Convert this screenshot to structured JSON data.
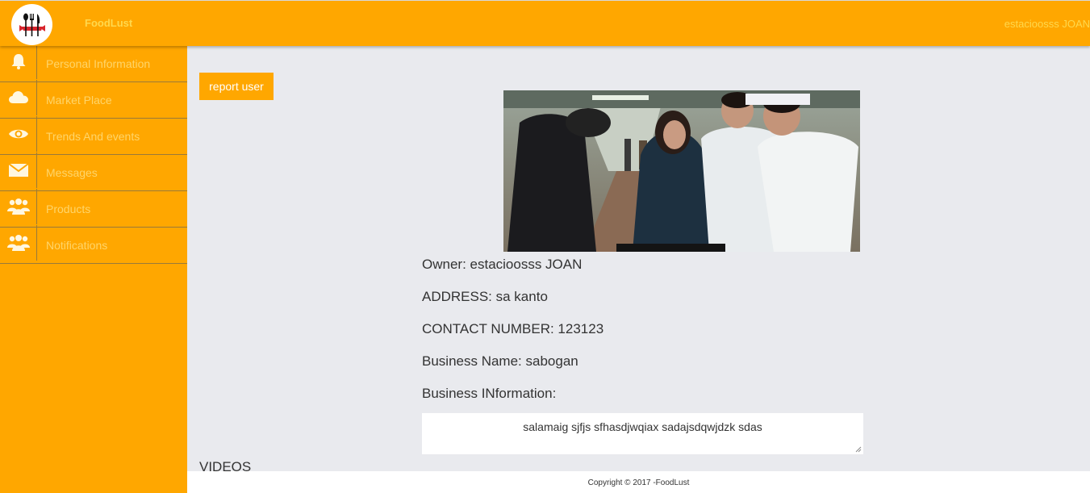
{
  "header": {
    "brand": "FoodLust",
    "user_name": "estacioosss JOAN",
    "logo_icon": "restaurant-logo-icon",
    "accent_color": "#ffa700"
  },
  "sidebar": {
    "items": [
      {
        "label": "Personal Information",
        "icon": "bell-icon"
      },
      {
        "label": "Market Place",
        "icon": "cloud-icon"
      },
      {
        "label": "Trends And events",
        "icon": "eye-icon"
      },
      {
        "label": "Messages",
        "icon": "envelope-icon"
      },
      {
        "label": "Products",
        "icon": "users-icon"
      },
      {
        "label": "Notifications",
        "icon": "users-icon"
      }
    ]
  },
  "main": {
    "report_button": "report user",
    "owner": "Owner: estacioosss JOAN",
    "address": "ADDRESS: sa kanto",
    "contact": "CONTACT NUMBER: 123123",
    "business_name": "Business Name: sabogan",
    "business_info_label": "Business INformation:",
    "business_info_value": "salamaig sjfjs sfhasdjwqiax sadajsdqwjdzk sdas",
    "videos_label": "VIDEOS"
  },
  "footer": {
    "copyright": "Copyright © 2017 -FoodLust"
  }
}
